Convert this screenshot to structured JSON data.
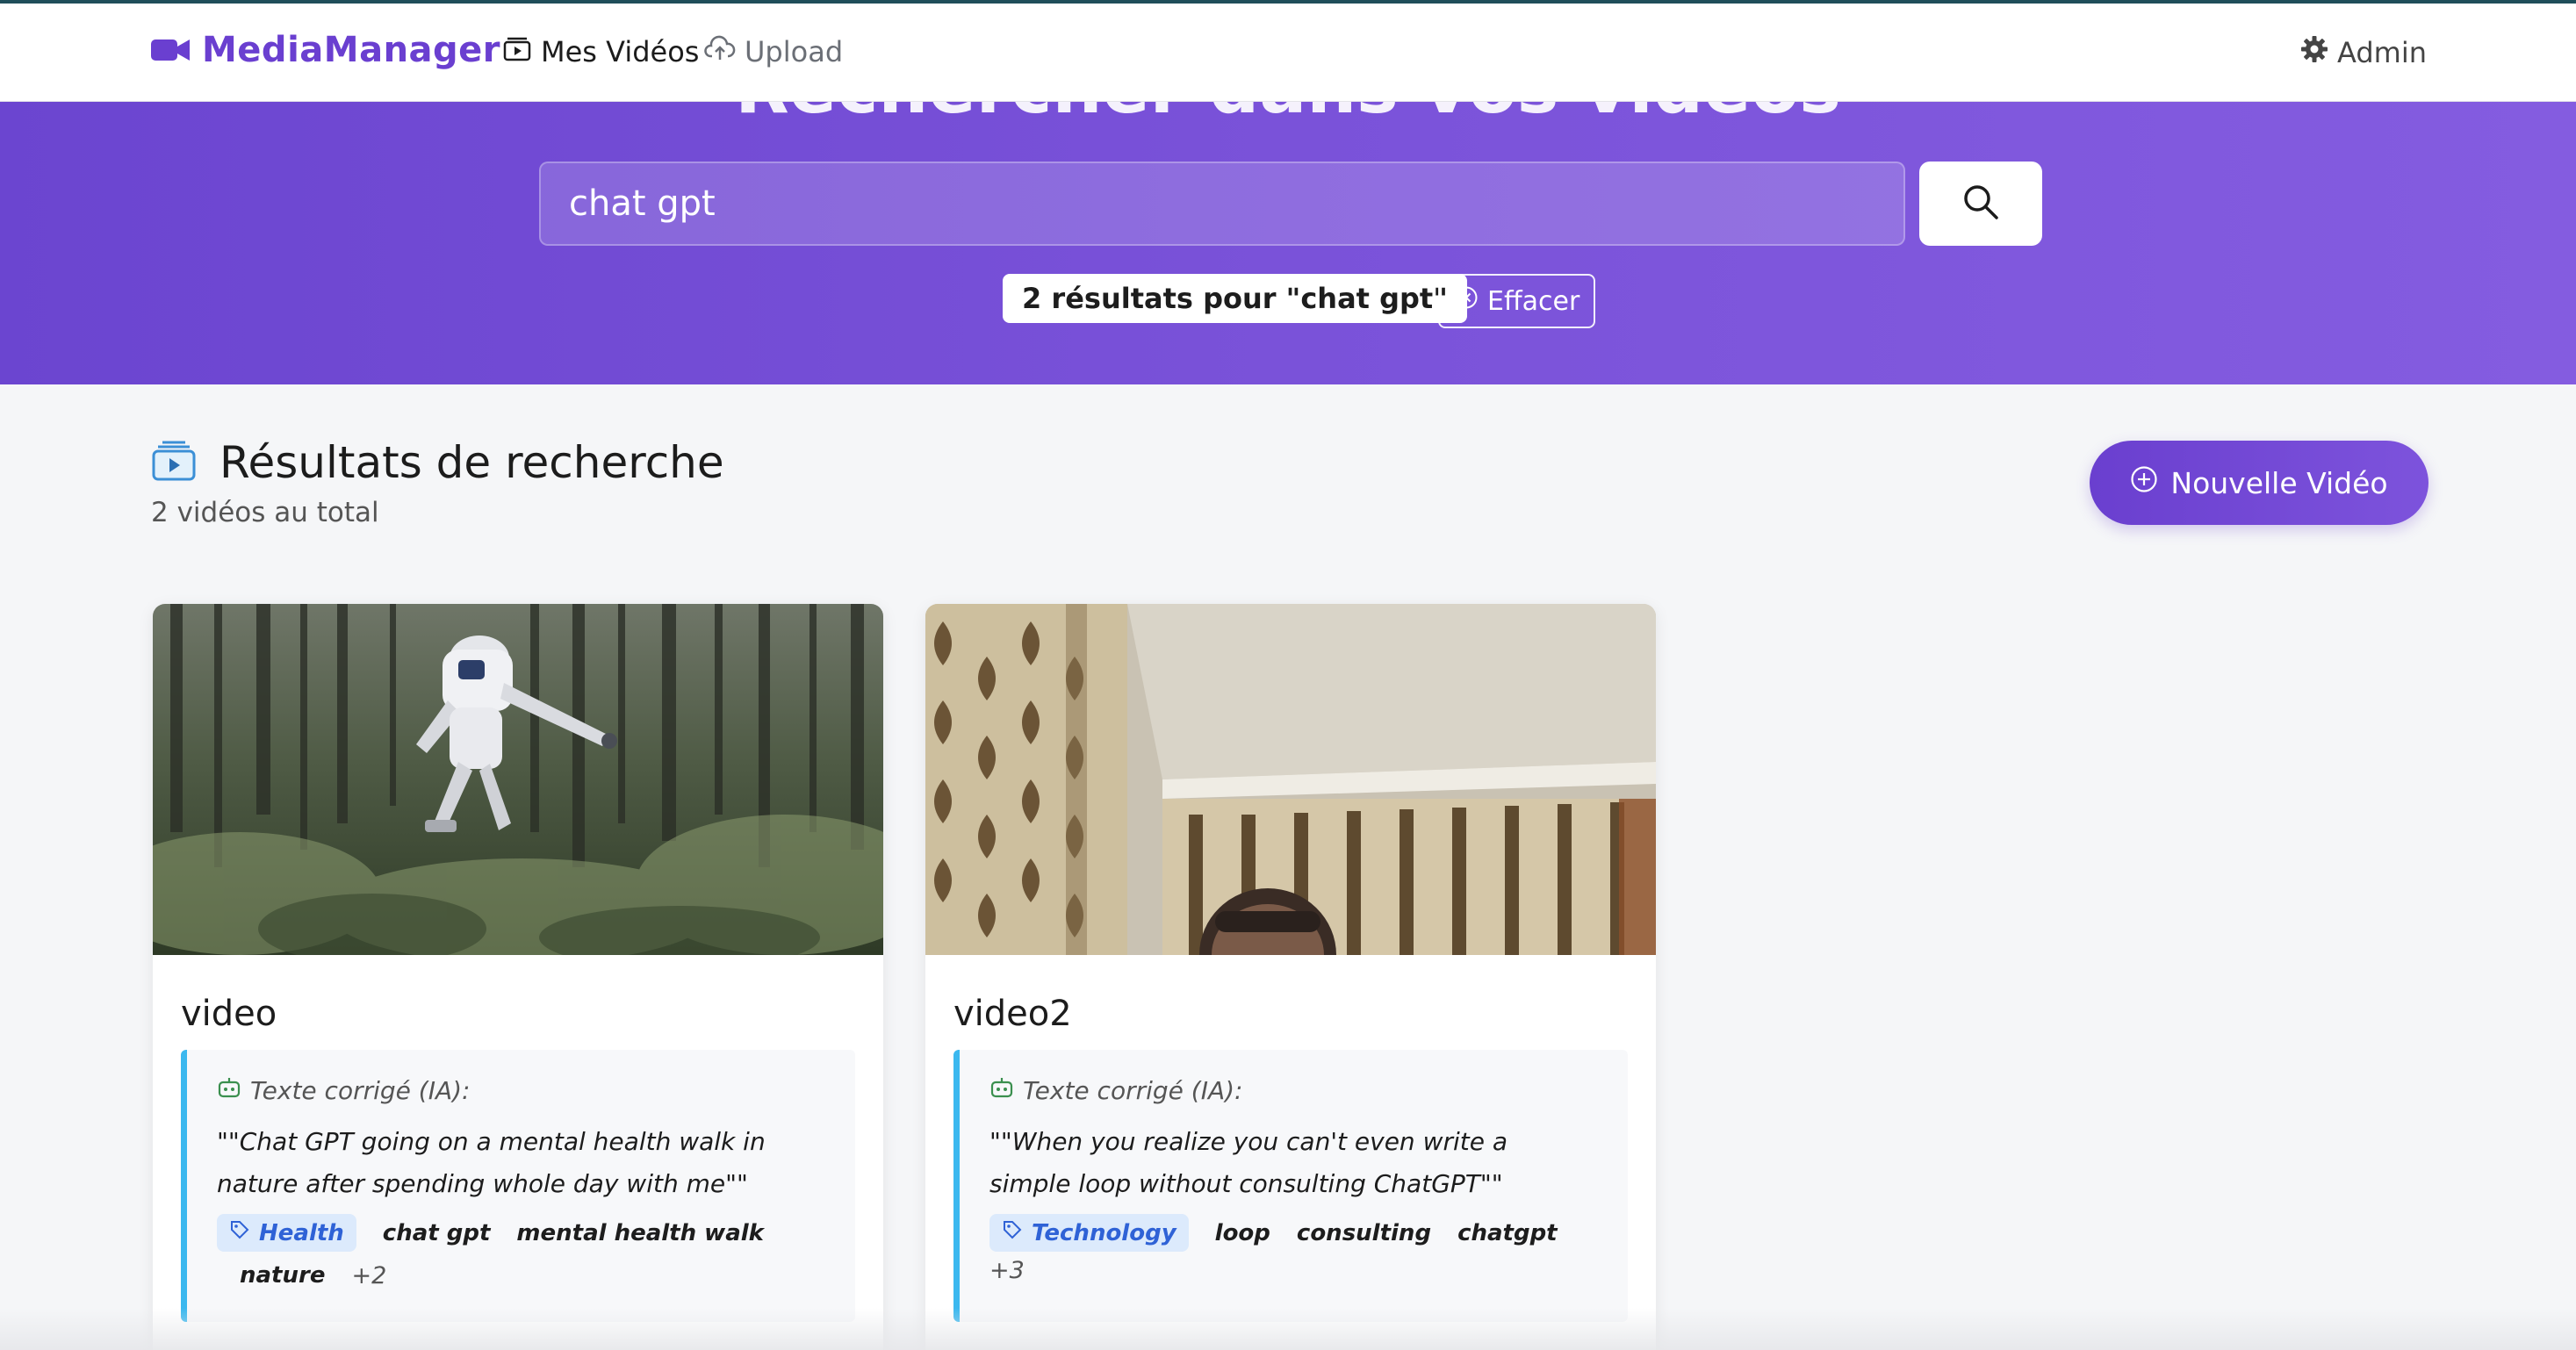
{
  "header": {
    "brand": "MediaManager",
    "brand_icon": "video-camera-icon",
    "nav": [
      {
        "label": "Mes Vidéos",
        "icon": "video-library-icon"
      },
      {
        "label": "Upload",
        "icon": "cloud-upload-icon"
      }
    ],
    "admin_label": "Admin",
    "admin_icon": "gear-icon"
  },
  "hero": {
    "title": "Rechercher dans vos vidéos",
    "search_value": "chat gpt",
    "search_icon": "search-icon",
    "results_text": "2 résultats pour \"chat gpt\"",
    "clear_label": "Effacer",
    "clear_icon": "close-circle-icon"
  },
  "section": {
    "title": "Résultats de recherche",
    "subtitle": "2 vidéos au total",
    "icon": "video-library-icon",
    "new_button": "Nouvelle Vidéo",
    "new_button_icon": "plus-circle-icon"
  },
  "videos": [
    {
      "title": "video",
      "ai_label": "Texte corrigé (IA):",
      "ai_text": "\"\"Chat GPT going on a mental health walk in nature after spending whole day with me\"\"",
      "category": "Health",
      "tags": [
        "chat gpt",
        "mental health walk",
        "nature"
      ],
      "more": "+2"
    },
    {
      "title": "video2",
      "ai_label": "Texte corrigé (IA):",
      "ai_text": "\"\"When you realize you can't even write a simple loop without consulting ChatGPT\"\"",
      "category": "Technology",
      "tags": [
        "loop",
        "consulting",
        "chatgpt"
      ],
      "more": "+3"
    }
  ],
  "colors": {
    "brand": "#6a3fd0",
    "hero_start": "#6b45d0",
    "hero_end": "#845ce0",
    "ai_border": "#3bb8ef",
    "tag_bg": "#dceafc",
    "tag_text": "#2f62d6"
  }
}
